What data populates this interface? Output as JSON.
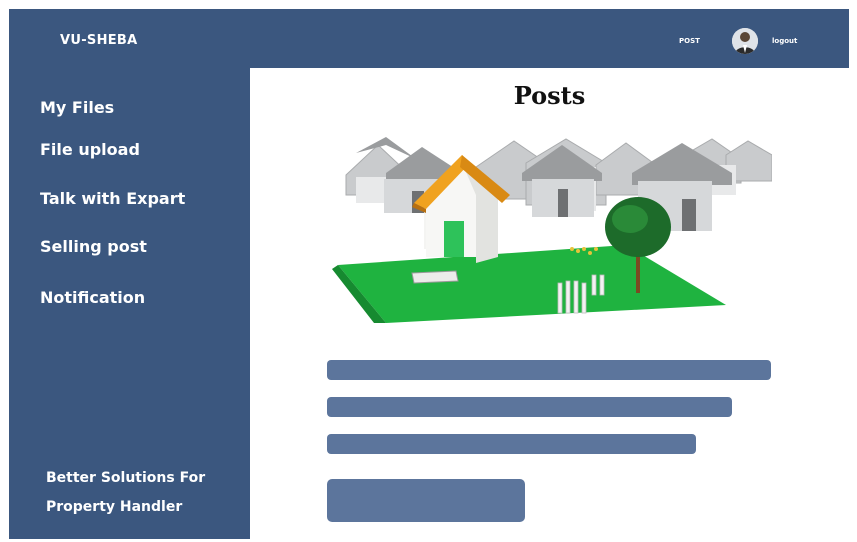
{
  "header": {
    "brand": "VU-SHEBA",
    "nav_post": "POST",
    "logout": "logout",
    "color": "#3b577f"
  },
  "sidebar": {
    "items": [
      {
        "label": "My Files"
      },
      {
        "label": "File upload"
      },
      {
        "label": "Talk with Expart"
      },
      {
        "label": "Selling post"
      },
      {
        "label": "Notification"
      }
    ],
    "tagline_line1": "Better Solutions For",
    "tagline_line2": "Property Handler"
  },
  "main": {
    "title": "Posts",
    "image_icon": "houses-illustration",
    "placeholder_color": "#5c759c"
  }
}
